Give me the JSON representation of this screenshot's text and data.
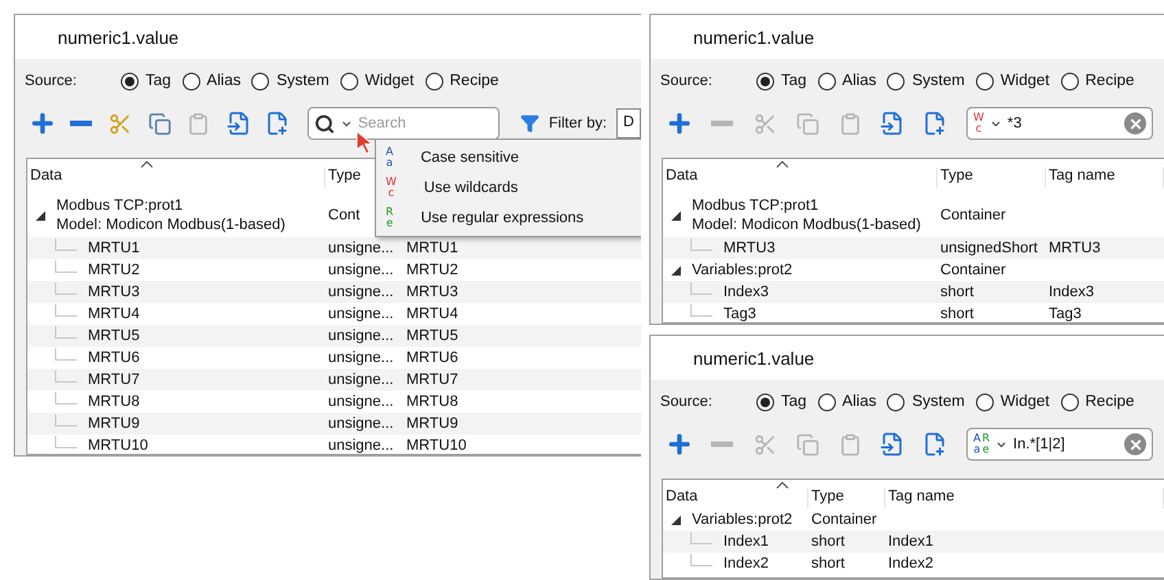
{
  "panels": [
    {
      "title": "numeric1.value",
      "source_label": "Source:",
      "options": [
        {
          "label": "Tag",
          "selected": true
        },
        {
          "label": "Alias",
          "selected": false
        },
        {
          "label": "System",
          "selected": false
        },
        {
          "label": "Widget",
          "selected": false
        },
        {
          "label": "Recipe",
          "selected": false
        }
      ],
      "tools": [
        {
          "kind": "add",
          "disabled": false
        },
        {
          "kind": "remove",
          "disabled": false
        },
        {
          "kind": "cut",
          "disabled": false
        },
        {
          "kind": "copy",
          "disabled": false
        },
        {
          "kind": "paste",
          "disabled": true
        },
        {
          "kind": "import",
          "disabled": false
        },
        {
          "kind": "import-new",
          "disabled": false
        }
      ],
      "search": {
        "mode": [
          {
            "kind": "magnifier"
          }
        ],
        "placeholder": "Search"
      },
      "filter": {
        "label": "Filter by:",
        "value": "D"
      },
      "columns": [
        "Data",
        "Type"
      ],
      "tree": [
        {
          "label": "Modbus TCP:prot1",
          "sublabel": "Model: Modicon Modbus(1-based)",
          "type": "Cont",
          "expanded": true,
          "children": [
            {
              "label": "MRTU1",
              "type": "unsigne...",
              "tag": "MRTU1"
            },
            {
              "label": "MRTU2",
              "type": "unsigne...",
              "tag": "MRTU2"
            },
            {
              "label": "MRTU3",
              "type": "unsigne...",
              "tag": "MRTU3"
            },
            {
              "label": "MRTU4",
              "type": "unsigne...",
              "tag": "MRTU4"
            },
            {
              "label": "MRTU5",
              "type": "unsigne...",
              "tag": "MRTU5"
            },
            {
              "label": "MRTU6",
              "type": "unsigne...",
              "tag": "MRTU6"
            },
            {
              "label": "MRTU7",
              "type": "unsigne...",
              "tag": "MRTU7"
            },
            {
              "label": "MRTU8",
              "type": "unsigne...",
              "tag": "MRTU8"
            },
            {
              "label": "MRTU9",
              "type": "unsigne...",
              "tag": "MRTU9"
            },
            {
              "label": "MRTU10",
              "type": "unsigne...",
              "tag": "MRTU10"
            }
          ]
        }
      ],
      "menu": [
        {
          "kind": "case",
          "top": "A",
          "bottom": "a",
          "label": "Case sensitive"
        },
        {
          "kind": "wildcard",
          "top": "W",
          "bottom": "c",
          "label": "Use wildcards"
        },
        {
          "kind": "regex",
          "top": "R",
          "bottom": "e",
          "label": "Use regular expressions"
        }
      ]
    },
    {
      "title": "numeric1.value",
      "source_label": "Source:",
      "options": [
        {
          "label": "Tag",
          "selected": true
        },
        {
          "label": "Alias",
          "selected": false
        },
        {
          "label": "System",
          "selected": false
        },
        {
          "label": "Widget",
          "selected": false
        },
        {
          "label": "Recipe",
          "selected": false
        }
      ],
      "tools": [
        {
          "kind": "add",
          "disabled": false
        },
        {
          "kind": "remove",
          "disabled": true
        },
        {
          "kind": "cut",
          "disabled": true
        },
        {
          "kind": "copy",
          "disabled": true
        },
        {
          "kind": "paste",
          "disabled": true
        },
        {
          "kind": "import",
          "disabled": false
        },
        {
          "kind": "import-new",
          "disabled": false
        }
      ],
      "search": {
        "mode": [
          {
            "kind": "wildcard",
            "top": "W",
            "bottom": "c"
          }
        ],
        "value": "*3",
        "clear": true
      },
      "columns": [
        "Data",
        "Type",
        "Tag name"
      ],
      "tree": [
        {
          "label": "Modbus TCP:prot1",
          "sublabel": "Model: Modicon Modbus(1-based)",
          "type": "Container",
          "expanded": true,
          "children": [
            {
              "label": "MRTU3",
              "type": "unsignedShort",
              "tag": "MRTU3"
            }
          ]
        },
        {
          "label": "Variables:prot2",
          "type": "Container",
          "expanded": true,
          "children": [
            {
              "label": "Index3",
              "type": "short",
              "tag": "Index3"
            },
            {
              "label": "Tag3",
              "type": "short",
              "tag": "Tag3"
            }
          ]
        }
      ]
    },
    {
      "title": "numeric1.value",
      "source_label": "Source:",
      "options": [
        {
          "label": "Tag",
          "selected": true
        },
        {
          "label": "Alias",
          "selected": false
        },
        {
          "label": "System",
          "selected": false
        },
        {
          "label": "Widget",
          "selected": false
        },
        {
          "label": "Recipe",
          "selected": false
        }
      ],
      "tools": [
        {
          "kind": "add",
          "disabled": false
        },
        {
          "kind": "remove",
          "disabled": true
        },
        {
          "kind": "cut",
          "disabled": true
        },
        {
          "kind": "copy",
          "disabled": true
        },
        {
          "kind": "paste",
          "disabled": true
        },
        {
          "kind": "import",
          "disabled": false
        },
        {
          "kind": "import-new",
          "disabled": false
        }
      ],
      "search": {
        "mode": [
          {
            "kind": "case",
            "top": "A",
            "bottom": "a"
          },
          {
            "kind": "regex",
            "top": "R",
            "bottom": "e"
          }
        ],
        "value": "In.*[1|2]",
        "clear": true
      },
      "columns": [
        "Data",
        "Type",
        "Tag name"
      ],
      "tree": [
        {
          "label": "Variables:prot2",
          "type": "Container",
          "expanded": true,
          "children": [
            {
              "label": "Index1",
              "type": "short",
              "tag": "Index1"
            },
            {
              "label": "Index2",
              "type": "short",
              "tag": "Index2"
            }
          ]
        }
      ]
    }
  ]
}
